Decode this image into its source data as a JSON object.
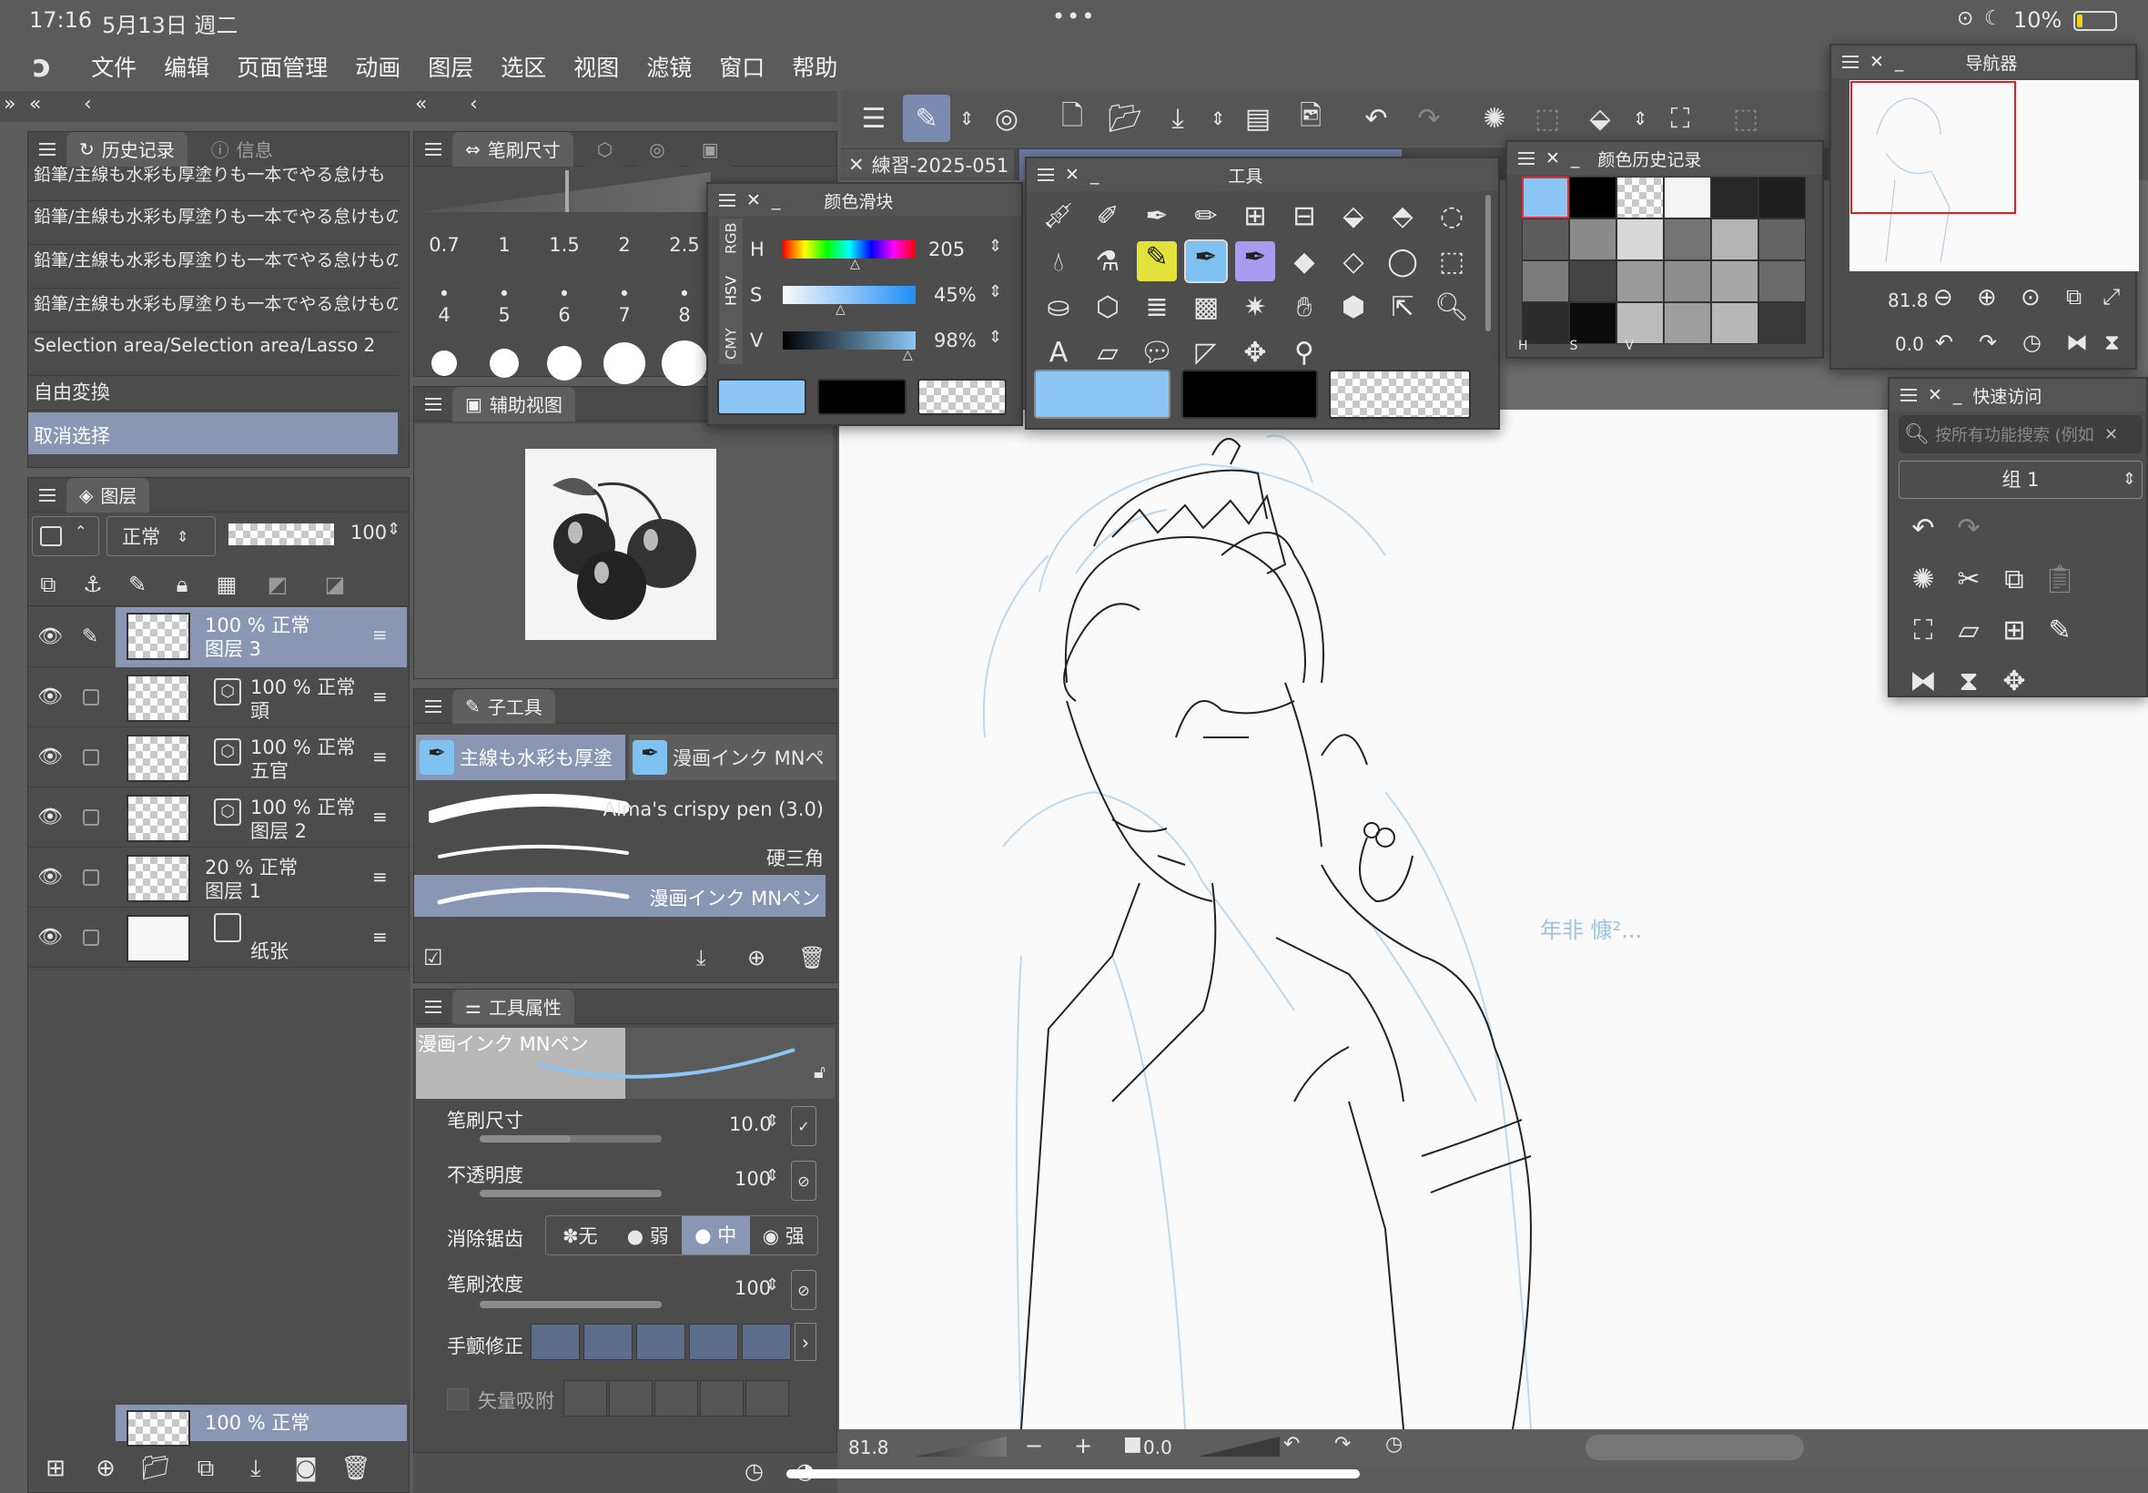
{
  "status_bar": {
    "time": "17:16",
    "date": "5月13日 週二",
    "battery": "10%"
  },
  "menu": [
    "文件",
    "编辑",
    "页面管理",
    "动画",
    "图层",
    "选区",
    "视图",
    "滤镜",
    "窗口",
    "帮助"
  ],
  "history": {
    "tab_label": "历史记录",
    "tab2_label": "信息",
    "items": [
      "鉛筆/主線も水彩も厚塗りも一本でやる怠けものブラ",
      "鉛筆/主線も水彩も厚塗りも一本でやる怠けものブラ",
      "鉛筆/主線も水彩も厚塗りも一本でやる怠けものブラ",
      "鉛筆/主線も水彩も厚塗りも一本でやる怠けものブラ",
      "Selection area/Selection area/Lasso 2",
      "自由変換",
      "取消选择"
    ]
  },
  "layers": {
    "tab_label": "图层",
    "blend_mode": "正常",
    "opacity": "100",
    "items": [
      {
        "line1": "100 % 正常",
        "line2": "图层 3",
        "selected": true
      },
      {
        "line1": "100 % 正常",
        "line2": "頭",
        "selected": false
      },
      {
        "line1": "100 % 正常",
        "line2": "五官",
        "selected": false
      },
      {
        "line1": "100 % 正常",
        "line2": "图层 2",
        "selected": false
      },
      {
        "line1": "20 % 正常",
        "line2": "图层 1",
        "selected": false
      },
      {
        "line1": "",
        "line2": "纸张",
        "selected": false
      }
    ],
    "bottom_row": "100 % 正常"
  },
  "brush_size": {
    "tab_label": "笔刷尺寸",
    "sizes_row1": [
      "0.7",
      "1",
      "1.5",
      "2",
      "2.5"
    ],
    "sizes_row2": [
      "4",
      "5",
      "6",
      "7",
      "8"
    ]
  },
  "sub_view": {
    "tab_label": "辅助视图"
  },
  "sub_tool": {
    "tab_label": "子工具",
    "tab_a": "主線も水彩も厚塗",
    "tab_b": "漫画インク MNペ",
    "brushes": [
      "Alma's crispy pen (3.0)",
      "硬三角",
      "漫画インク MNペン"
    ]
  },
  "tool_property": {
    "tab_label": "工具属性",
    "tool_name": "漫画インク MNペン",
    "brush_size_label": "笔刷尺寸",
    "brush_size_value": "10.0",
    "opacity_label": "不透明度",
    "opacity_value": "100",
    "antialias_label": "消除锯齿",
    "antialias_options": [
      "无",
      "弱",
      "中",
      "强"
    ],
    "density_label": "笔刷浓度",
    "density_value": "100",
    "stabilizer_label": "手颤修正",
    "vector_label": "矢量吸附"
  },
  "color_slider": {
    "title": "颜色滑块",
    "tabs": [
      "RGB",
      "HSV",
      "CMY"
    ],
    "h_label": "H",
    "h_value": "205",
    "s_label": "S",
    "s_value": "45%",
    "v_label": "V",
    "v_value": "98%",
    "main_color": "#8cc6f6"
  },
  "tool_palette": {
    "title": "工具"
  },
  "color_history": {
    "title": "颜色历史记录",
    "labels": [
      "H",
      "S",
      "V"
    ]
  },
  "navigator": {
    "title": "导航器",
    "zoom": "81.8",
    "angle": "0.0"
  },
  "quick_access": {
    "title": "快速访问",
    "search_placeholder": "按所有功能搜索 (例如",
    "set_label": "组 1"
  },
  "canvas": {
    "tab1": "練習-2025-051",
    "tab2": "",
    "zoom": "81.8",
    "angle": "0.0",
    "handwriting": "年非 慷²..."
  },
  "colors": {
    "accent": "#7b8bb0",
    "selected_row": "#8a97b4",
    "main_color": "#8cc6f6"
  }
}
